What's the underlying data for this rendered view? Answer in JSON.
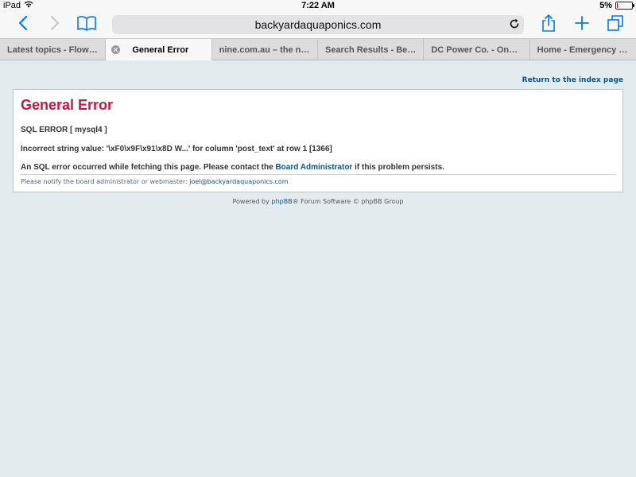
{
  "status_bar": {
    "device": "iPad",
    "time": "7:22 AM",
    "battery": "5%",
    "battery_level": 0.05
  },
  "toolbar": {
    "url": "backyardaquaponics.com"
  },
  "tabs": [
    {
      "label": "Latest topics - Flow F..."
    },
    {
      "label": "General Error"
    },
    {
      "label": "nine.com.au – the ne..."
    },
    {
      "label": "Search Results - Bees..."
    },
    {
      "label": "DC Power Co. - OnMa..."
    },
    {
      "label": "Home - Emergency W..."
    }
  ],
  "page": {
    "return_link": "Return to the index page",
    "title": "General Error",
    "sql_error": "SQL ERROR [ mysql4 ]",
    "error_detail": "Incorrect string value: '\\xF0\\x9F\\x91\\x8D W...' for column 'post_text' at row 1 [1366]",
    "message_before": "An SQL error occurred while fetching this page. Please contact the ",
    "message_link": "Board Administrator",
    "message_after": " if this problem persists.",
    "notify_text": "Please notify the board administrator or webmaster: ",
    "notify_email": "joel@backyardaquaponics.com",
    "powered_before": "Powered by ",
    "powered_link": "phpBB",
    "powered_after": "® Forum Software © phpBB Group"
  },
  "colors": {
    "accent": "#007aff",
    "error_title": "#d31141",
    "link": "#105289",
    "page_bg": "#e3ebef"
  }
}
